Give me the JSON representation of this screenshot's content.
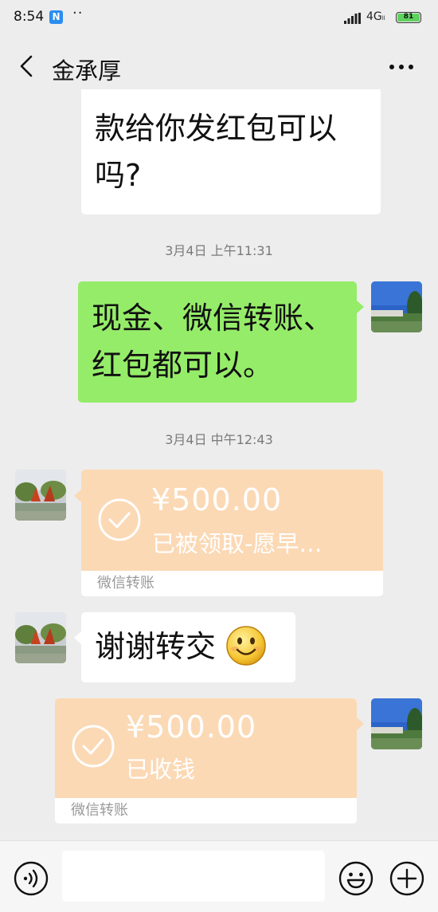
{
  "status_bar": {
    "time": "8:54",
    "notification_badge": "N",
    "dots": "··",
    "network": "4G",
    "network_sub": "ll",
    "battery": "81"
  },
  "header": {
    "title": "金承厚",
    "back_icon": "chevron-left-icon",
    "more_icon": "more-horizontal-icon"
  },
  "messages": {
    "m1": {
      "line1": "款给你发红包可以",
      "line2": "吗?"
    },
    "ts1": "3月4日 上午11:31",
    "m2": {
      "line1": "现金、微信转账、",
      "line2": "红包都可以。"
    },
    "ts2": "3月4日 中午12:43",
    "t1": {
      "amount": "¥500.00",
      "status": "已被领取-愿早…",
      "label": "微信转账"
    },
    "m3": {
      "text": "谢谢转交",
      "emoji": "smiling-face-emoji"
    },
    "t2": {
      "amount": "¥500.00",
      "status": "已收钱",
      "label": "微信转账"
    }
  },
  "input_bar": {
    "voice_icon": "voice-icon",
    "emoji_icon": "smiley-icon",
    "plus_icon": "plus-circle-icon",
    "input_placeholder": ""
  },
  "colors": {
    "background": "#ededed",
    "green_bubble": "#95ec69",
    "transfer_orange": "#fbd9b5"
  }
}
